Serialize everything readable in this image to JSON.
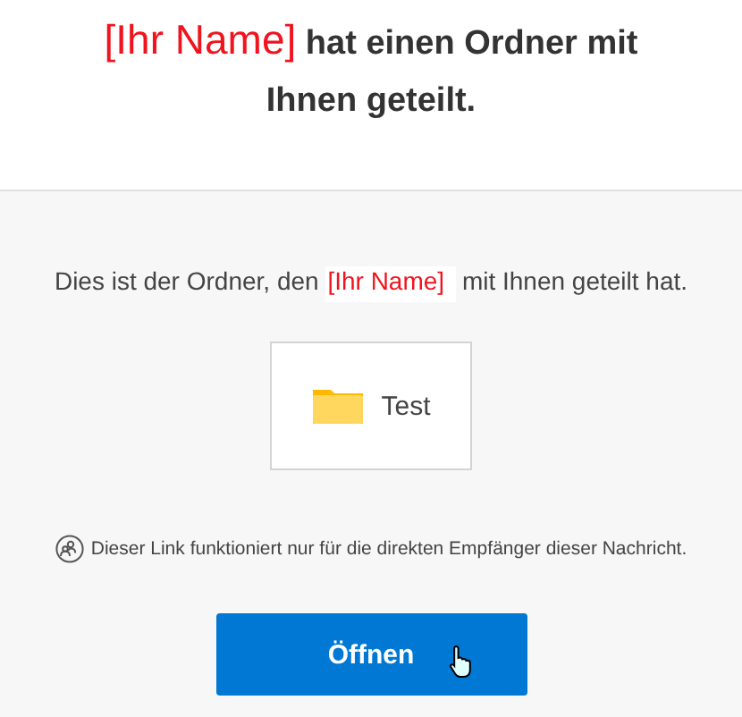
{
  "heading": {
    "name": "[Ihr Name]",
    "text": "hat einen Ordner mit Ihnen geteilt."
  },
  "message": {
    "before": "Dies ist der Ordner, den",
    "name": "[Ihr Name]",
    "after": "mit Ihnen geteilt hat."
  },
  "item": {
    "label": "Test"
  },
  "notice": "Dieser Link funktioniert nur für die direkten Empfänger dieser Nachricht.",
  "button": "Öffnen"
}
